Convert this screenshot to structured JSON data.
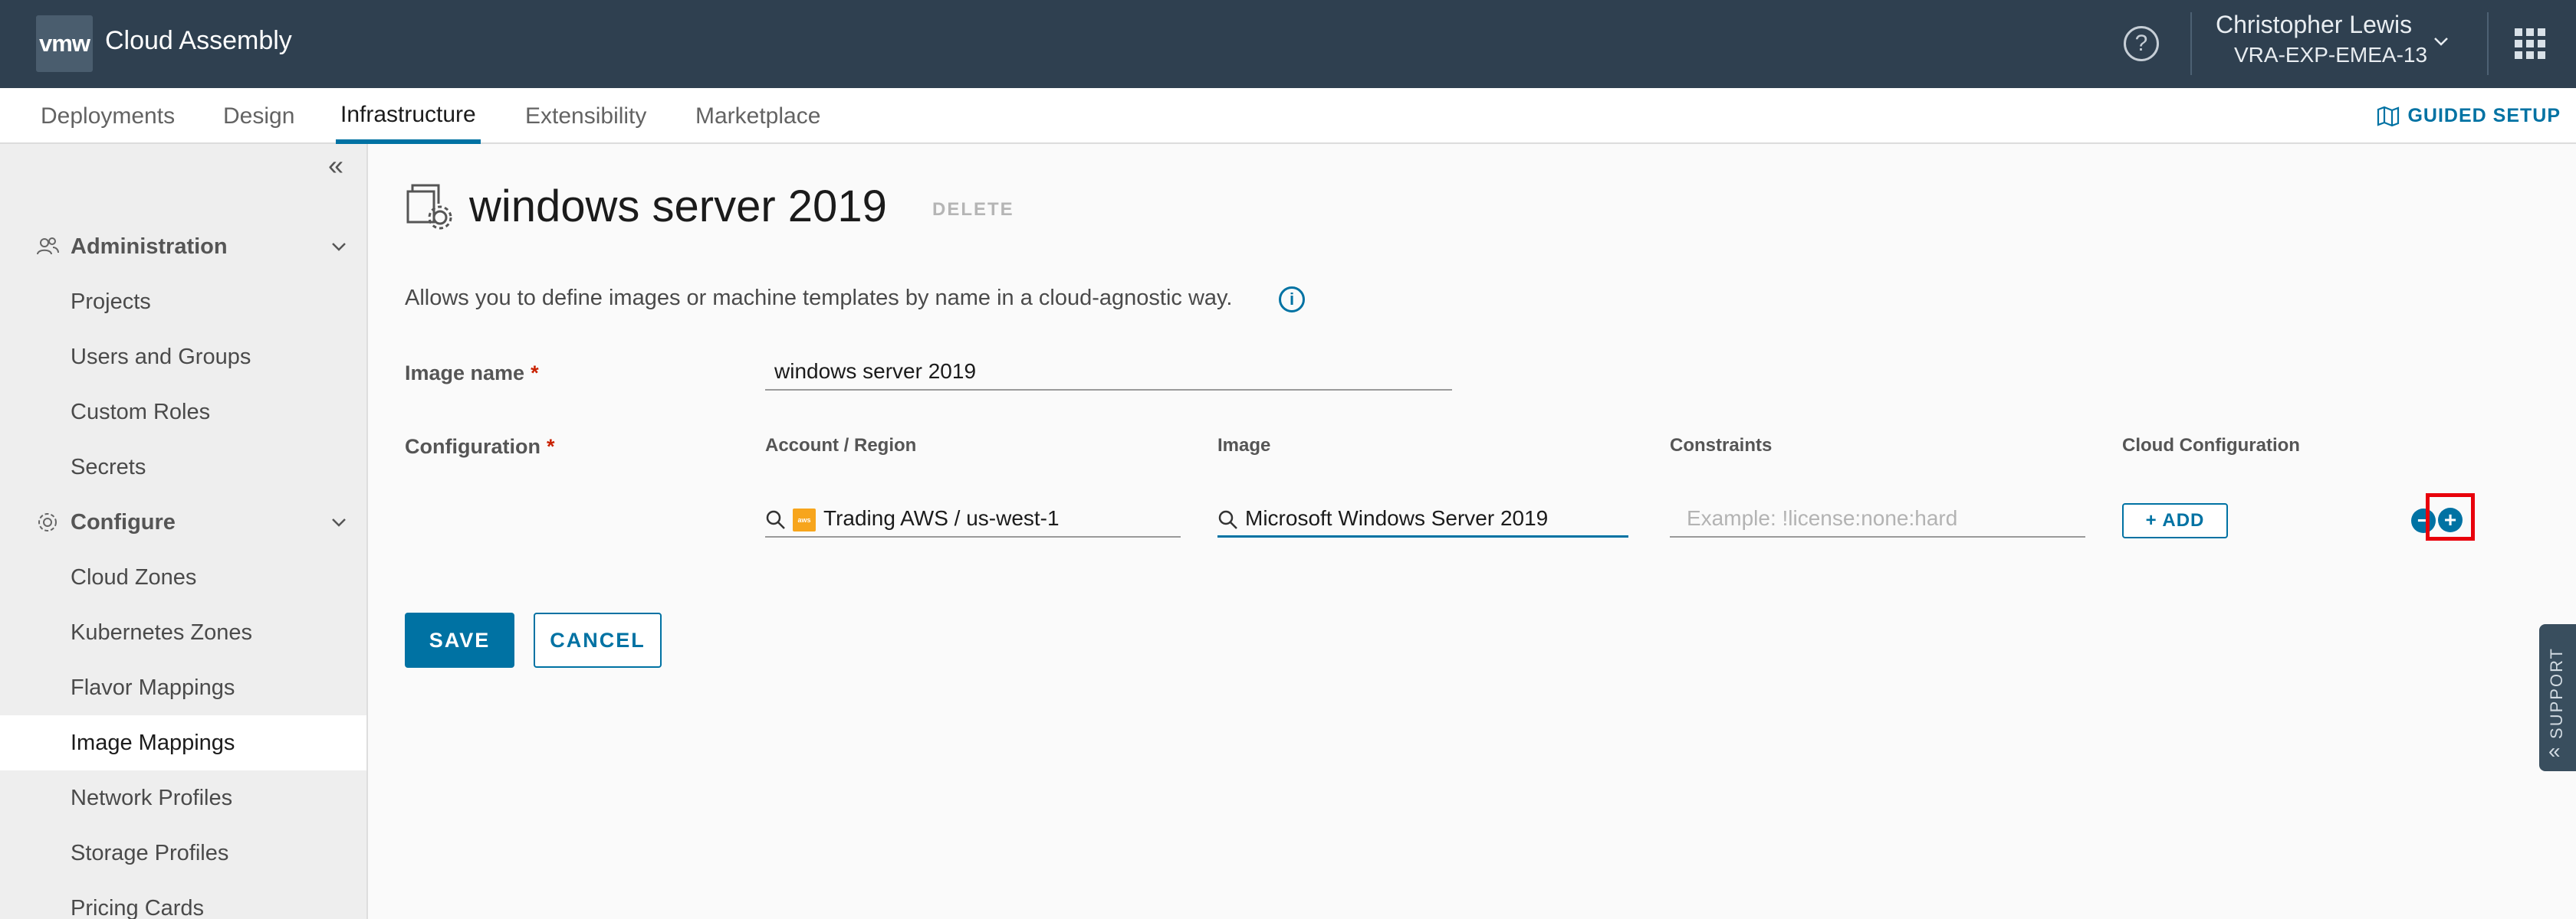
{
  "header": {
    "logo_text": "vmw",
    "app_title": "Cloud Assembly",
    "user_name": "Christopher Lewis",
    "user_org": "VRA-EXP-EMEA-13"
  },
  "nav": {
    "tabs": [
      "Deployments",
      "Design",
      "Infrastructure",
      "Extensibility",
      "Marketplace"
    ],
    "active_tab": "Infrastructure",
    "guided_setup": "GUIDED SETUP"
  },
  "sidebar": {
    "groups": [
      {
        "label": "Administration",
        "items": [
          "Projects",
          "Users and Groups",
          "Custom Roles",
          "Secrets"
        ]
      },
      {
        "label": "Configure",
        "items": [
          "Cloud Zones",
          "Kubernetes Zones",
          "Flavor Mappings",
          "Image Mappings",
          "Network Profiles",
          "Storage Profiles",
          "Pricing Cards"
        ]
      }
    ],
    "active_item": "Image Mappings"
  },
  "page": {
    "title": "windows server 2019",
    "delete_label": "DELETE",
    "description": "Allows you to define images or machine templates by name in a cloud-agnostic way.",
    "image_name_label": "Image name",
    "image_name_value": "windows server 2019",
    "configuration_label": "Configuration",
    "required_mark": "*",
    "columns": {
      "account_region": "Account / Region",
      "image": "Image",
      "constraints": "Constraints",
      "cloud_configuration": "Cloud Configuration"
    },
    "row": {
      "account_region_value": "Trading AWS / us-west-1",
      "image_value": "Microsoft Windows Server 2019",
      "constraints_placeholder": "Example: !license:none:hard",
      "add_label": "+ ADD"
    },
    "save_label": "SAVE",
    "cancel_label": "CANCEL"
  },
  "support_tab": "SUPPORT",
  "colors": {
    "header_bg": "#2f4050",
    "accent": "#0072a3",
    "required": "#c92100",
    "highlight": "#e8000b",
    "aws_badge": "#f7a51c"
  }
}
